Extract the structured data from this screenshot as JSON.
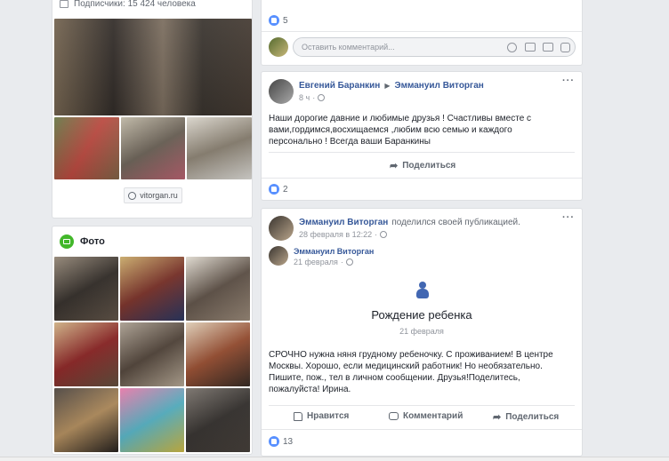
{
  "left": {
    "subscribers": "Подписчики: 15 424 человека",
    "website": "vitorgan.ru",
    "photo_section_title": "Фото"
  },
  "post_top": {
    "likes": "5",
    "comment_placeholder": "Оставить комментарий..."
  },
  "post1": {
    "author": "Евгений Баранкин",
    "target": "Эммануил Виторган",
    "time": "8 ч",
    "text": "Наши дорогие давние и любимые друзья ! Счастливы вместе с вами,гордимся,восхищаемся ,любим всю семью и каждого персонально ! Всегда ваши Баранкины",
    "share": "Поделиться",
    "likes": "2"
  },
  "post2": {
    "author": "Эммануил Виторган",
    "shared_text": "поделился своей публикацией.",
    "time": "28 февраля в 12:22",
    "inner_author": "Эммануил Виторган",
    "inner_time": "21 февраля",
    "event_title": "Рождение ребенка",
    "event_date": "21 февраля",
    "text": "СРОЧНО нужна няня грудному ребеночку. С проживанием! В центре Москвы. Хорошо, если медицинский работник! Но необязательно. Пишите, пож., тел в личном сообщении. Друзья!Поделитесь, пожалуйста! Ирина.",
    "like_btn": "Нравится",
    "comment_btn": "Комментарий",
    "share_btn": "Поделиться",
    "likes": "13"
  },
  "colors": {
    "link": "#365899",
    "like": "#5890ff",
    "photo_icon": "#42b72a"
  }
}
